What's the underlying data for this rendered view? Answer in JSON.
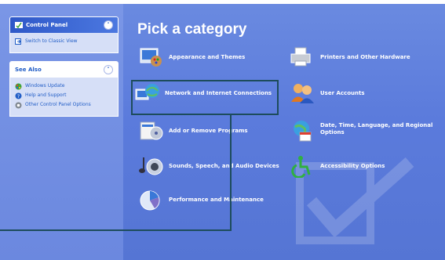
{
  "left_pane": {
    "control_panel": {
      "title": "Control Panel",
      "items": [
        {
          "label": "Switch to Classic View",
          "icon": "switch-view-icon"
        }
      ]
    },
    "see_also": {
      "title": "See Also",
      "items": [
        {
          "label": "Windows Update",
          "icon": "windows-update-icon"
        },
        {
          "label": "Help and Support",
          "icon": "help-icon"
        },
        {
          "label": "Other Control Panel Options",
          "icon": "options-icon"
        }
      ]
    }
  },
  "main": {
    "heading": "Pick a category",
    "categories": [
      {
        "label": "Appearance and Themes",
        "icon": "appearance-themes-icon"
      },
      {
        "label": "Network and Internet Connections",
        "icon": "network-icon"
      },
      {
        "label": "Add or Remove Programs",
        "icon": "add-remove-programs-icon"
      },
      {
        "label": "Sounds, Speech, and Audio Devices",
        "icon": "sounds-icon"
      },
      {
        "label": "Performance and Maintenance",
        "icon": "performance-icon"
      },
      {
        "label": "Printers and Other Hardware",
        "icon": "printers-icon"
      },
      {
        "label": "User Accounts",
        "icon": "user-accounts-icon"
      },
      {
        "label": "Date, Time, Language, and Regional Options",
        "icon": "date-time-icon"
      },
      {
        "label": "Accessibility Options",
        "icon": "accessibility-icon"
      }
    ]
  },
  "colors": {
    "background": "#5b7bdc",
    "highlight_border": "#1d4c5c",
    "link": "#215dc6"
  }
}
